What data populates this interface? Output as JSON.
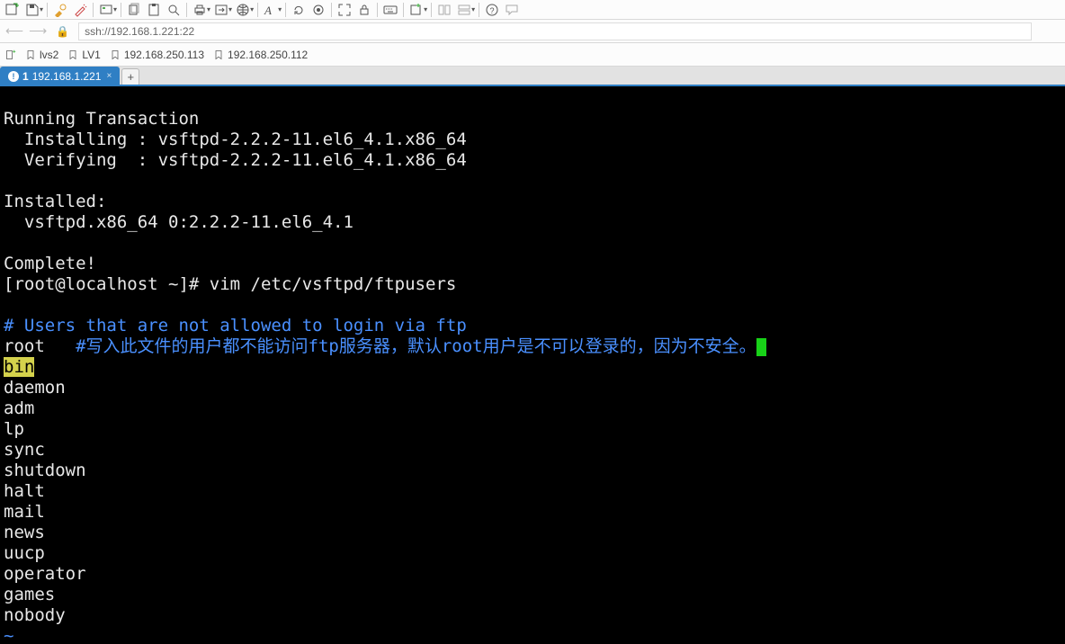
{
  "address": "ssh://192.168.1.221:22",
  "bookmarks": [
    {
      "label": "lvs2"
    },
    {
      "label": "LV1"
    },
    {
      "label": "192.168.250.113"
    },
    {
      "label": "192.168.250.112"
    }
  ],
  "tabs": {
    "active": {
      "index": "1",
      "label": "192.168.1.221"
    },
    "add": "+"
  },
  "terminal": {
    "l1": "Running Transaction",
    "l2": "  Installing : vsftpd-2.2.2-11.el6_4.1.x86_64",
    "l3": "  Verifying  : vsftpd-2.2.2-11.el6_4.1.x86_64",
    "l4": "",
    "l5": "Installed:",
    "l6": "  vsftpd.x86_64 0:2.2.2-11.el6_4.1",
    "l7": "",
    "l8": "Complete!",
    "l9a": "[root@localhost ~]# ",
    "l9b": "vim /etc/vsftpd/ftpusers",
    "l10": "",
    "comment_header": "# Users that are not allowed to login via ftp",
    "root_user": "root",
    "root_note": "   #写入此文件的用户都不能访问ftp服务器，默认root用户是不可以登录的，因为不安全。",
    "highlighted": "bin",
    "users": {
      "u1": "daemon",
      "u2": "adm",
      "u3": "lp",
      "u4": "sync",
      "u5": "shutdown",
      "u6": "halt",
      "u7": "mail",
      "u8": "news",
      "u9": "uucp",
      "u10": "operator",
      "u11": "games",
      "u12": "nobody"
    },
    "tilde": "~"
  }
}
